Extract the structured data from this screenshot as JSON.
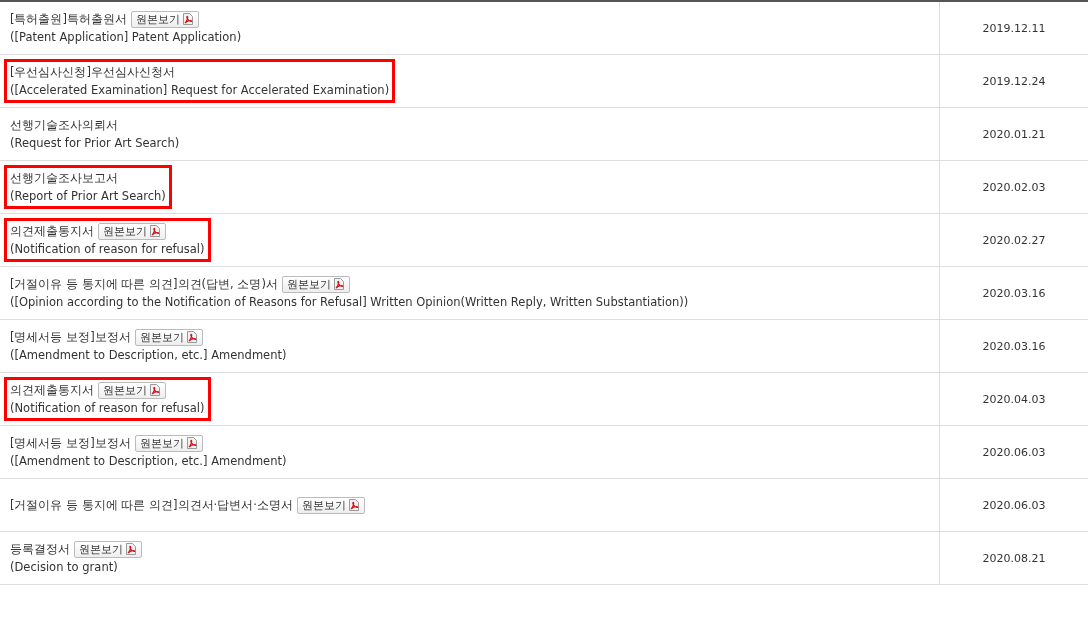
{
  "rows": [
    {
      "title": "[특허출원]특허출원서",
      "subtitle": "([Patent Application] Patent Application)",
      "pdf_button": "원본보기",
      "date": "2019.12.11",
      "highlighted": false
    },
    {
      "title": "[우선심사신청]우선심사신청서",
      "subtitle": "([Accelerated Examination] Request for Accelerated Examination)",
      "date": "2019.12.24",
      "highlighted": true
    },
    {
      "title": "선행기술조사의뢰서",
      "subtitle": "(Request for Prior Art Search)",
      "date": "2020.01.21",
      "highlighted": false
    },
    {
      "title": "선행기술조사보고서",
      "subtitle": "(Report of Prior Art Search)",
      "date": "2020.02.03",
      "highlighted": true
    },
    {
      "title": "의견제출통지서",
      "subtitle": "(Notification of reason for refusal)",
      "pdf_button": "원본보기",
      "date": "2020.02.27",
      "highlighted": true
    },
    {
      "title": "[거절이유 등 통지에 따른 의견]의견(답변, 소명)서",
      "subtitle": "([Opinion according to the Notification of Reasons for Refusal] Written Opinion(Written Reply, Written Substantiation))",
      "pdf_button": "원본보기",
      "date": "2020.03.16",
      "highlighted": false
    },
    {
      "title": "[명세서등 보정]보정서",
      "subtitle": "([Amendment to Description, etc.] Amendment)",
      "pdf_button": "원본보기",
      "date": "2020.03.16",
      "highlighted": false
    },
    {
      "title": "의견제출통지서",
      "subtitle": "(Notification of reason for refusal)",
      "pdf_button": "원본보기",
      "date": "2020.04.03",
      "highlighted": true
    },
    {
      "title": "[명세서등 보정]보정서",
      "subtitle": "([Amendment to Description, etc.] Amendment)",
      "pdf_button": "원본보기",
      "date": "2020.06.03",
      "highlighted": false
    },
    {
      "title": "[거절이유 등 통지에 따른 의견]의견서·답변서·소명서",
      "pdf_button": "원본보기",
      "date": "2020.06.03",
      "highlighted": false
    },
    {
      "title": "등록결정서",
      "subtitle": "(Decision to grant)",
      "pdf_button": "원본보기",
      "date": "2020.08.21",
      "highlighted": false
    }
  ]
}
